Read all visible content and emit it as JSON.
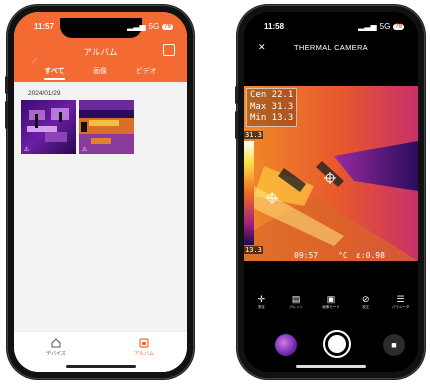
{
  "left_phone": {
    "status": {
      "time": "11:57",
      "signal": "5G",
      "battery": "79"
    },
    "header": {
      "title": "アルバム"
    },
    "tabs": [
      {
        "label": "すべて",
        "active": true
      },
      {
        "label": "画像",
        "active": false
      },
      {
        "label": "ビデオ",
        "active": false
      }
    ],
    "date_group": "2024/01/29",
    "thumbnails": 2,
    "nav": [
      {
        "label": "デバイス",
        "icon": "home-icon",
        "active": false
      },
      {
        "label": "アルバム",
        "icon": "album-icon",
        "active": true
      }
    ]
  },
  "right_phone": {
    "status": {
      "time": "11:58",
      "signal": "5G",
      "battery": "79"
    },
    "title": "THERMAL CAMERA",
    "readings": {
      "cen": "Cen 22.1",
      "max": "Max 31.3",
      "min": "Min 13.3"
    },
    "scale": {
      "high": "31.3",
      "low": "13.3"
    },
    "timestamp": "09:57",
    "unit": "°C",
    "emissivity": "ε:0.98",
    "tools": [
      {
        "label": "測定",
        "icon": "crosshair-icon"
      },
      {
        "label": "パレット",
        "icon": "palette-icon"
      },
      {
        "label": "画像モード",
        "icon": "image-mode-icon"
      },
      {
        "label": "校正",
        "icon": "calibrate-icon"
      },
      {
        "label": "パラメータ",
        "icon": "sliders-icon"
      }
    ],
    "accent": "#f36b32"
  }
}
